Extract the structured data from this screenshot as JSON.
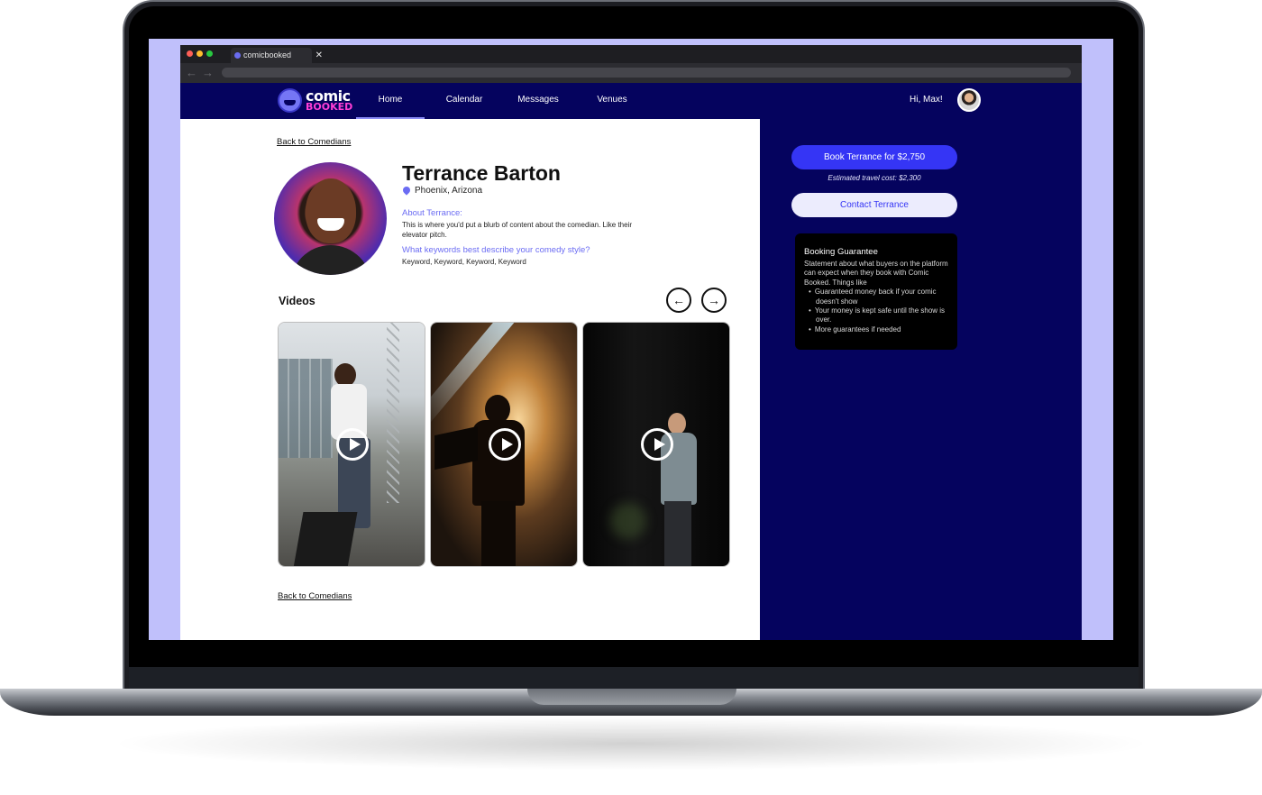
{
  "browser": {
    "tab_title": "comicbooked",
    "tab_close": "✕",
    "back_glyph": "←",
    "forward_glyph": "→"
  },
  "header": {
    "logo_top": "comic",
    "logo_bottom": "BOOKED",
    "nav": [
      {
        "label": "Home",
        "active": true
      },
      {
        "label": "Calendar",
        "active": false
      },
      {
        "label": "Messages",
        "active": false
      },
      {
        "label": "Venues",
        "active": false
      }
    ],
    "greeting": "Hi, Max!"
  },
  "profile": {
    "back_link": "Back to Comedians",
    "name": "Terrance Barton",
    "location": "Phoenix, Arizona",
    "about_label": "About Terrance:",
    "about_text": "This is where you'd put a blurb of content about the comedian. Like their elevator pitch.",
    "keywords_label": "What keywords best describe your comedy style?",
    "keywords_text": "Keyword, Keyword, Keyword, Keyword"
  },
  "videos": {
    "title": "Videos",
    "prev_icon": "←",
    "next_icon": "→"
  },
  "sidebar": {
    "book_button": "Book Terrance for $2,750",
    "travel_cost": "Estimated travel cost: $2,300",
    "contact_button": "Contact Terrance",
    "guarantee_title": "Booking Guarantee",
    "guarantee_body": "Statement about what buyers on the platform can expect when they book with Comic Booked. Things like",
    "guarantee_items": [
      "Guaranteed money back if your comic doesn't show",
      "Your money is kept safe until the show is over.",
      "More guarantees if needed"
    ]
  },
  "colors": {
    "navy": "#05035e",
    "accent": "#3535f5",
    "lavender": "#c0c0fb",
    "logo_pink": "#ff3ed6",
    "link_purple": "#6b6cf3"
  }
}
